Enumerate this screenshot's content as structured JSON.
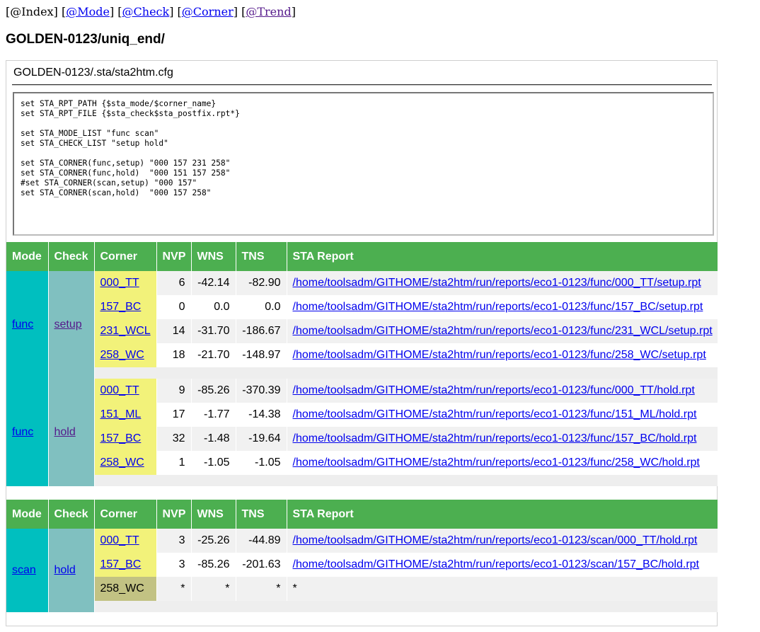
{
  "nav": {
    "open": "[",
    "close": "]",
    "index": "@Index",
    "mode": "@Mode",
    "check": "@Check",
    "corner": "@Corner",
    "trend": "@Trend"
  },
  "page_title": "GOLDEN-0123/uniq_end/",
  "config": {
    "title": "GOLDEN-0123/.sta/sta2htm.cfg",
    "content": "set STA_RPT_PATH {$sta_mode/$corner_name}\nset STA_RPT_FILE {$sta_check$sta_postfix.rpt*}\n\nset STA_MODE_LIST \"func scan\"\nset STA_CHECK_LIST \"setup hold\"\n\nset STA_CORNER(func,setup) \"000 157 231 258\"\nset STA_CORNER(func,hold)  \"000 151 157 258\"\n#set STA_CORNER(scan,setup) \"000 157\"\nset STA_CORNER(scan,hold)  \"000 157 258\""
  },
  "headers": [
    "Mode",
    "Check",
    "Corner",
    "NVP",
    "WNS",
    "TNS",
    "STA Report"
  ],
  "table1": {
    "groups": [
      {
        "mode": "func",
        "check": "setup",
        "rows": [
          {
            "corner": "000_TT",
            "nvp": "6",
            "wns": "-42.14",
            "tns": "-82.90",
            "report": "/home/toolsadm/GITHOME/sta2htm/run/reports/eco1-0123/func/000_TT/setup.rpt"
          },
          {
            "corner": "157_BC",
            "nvp": "0",
            "wns": "0.0",
            "tns": "0.0",
            "report": "/home/toolsadm/GITHOME/sta2htm/run/reports/eco1-0123/func/157_BC/setup.rpt"
          },
          {
            "corner": "231_WCL",
            "nvp": "14",
            "wns": "-31.70",
            "tns": "-186.67",
            "report": "/home/toolsadm/GITHOME/sta2htm/run/reports/eco1-0123/func/231_WCL/setup.rpt"
          },
          {
            "corner": "258_WC",
            "nvp": "18",
            "wns": "-21.70",
            "tns": "-148.97",
            "report": "/home/toolsadm/GITHOME/sta2htm/run/reports/eco1-0123/func/258_WC/setup.rpt"
          }
        ]
      },
      {
        "mode": "func",
        "check": "hold",
        "rows": [
          {
            "corner": "000_TT",
            "nvp": "9",
            "wns": "-85.26",
            "tns": "-370.39",
            "report": "/home/toolsadm/GITHOME/sta2htm/run/reports/eco1-0123/func/000_TT/hold.rpt"
          },
          {
            "corner": "151_ML",
            "nvp": "17",
            "wns": "-1.77",
            "tns": "-14.38",
            "report": "/home/toolsadm/GITHOME/sta2htm/run/reports/eco1-0123/func/151_ML/hold.rpt"
          },
          {
            "corner": "157_BC",
            "nvp": "32",
            "wns": "-1.48",
            "tns": "-19.64",
            "report": "/home/toolsadm/GITHOME/sta2htm/run/reports/eco1-0123/func/157_BC/hold.rpt"
          },
          {
            "corner": "258_WC",
            "nvp": "1",
            "wns": "-1.05",
            "tns": "-1.05",
            "report": "/home/toolsadm/GITHOME/sta2htm/run/reports/eco1-0123/func/258_WC/hold.rpt"
          }
        ]
      }
    ]
  },
  "table2": {
    "groups": [
      {
        "mode": "scan",
        "check": "hold",
        "rows": [
          {
            "corner": "000_TT",
            "nvp": "3",
            "wns": "-25.26",
            "tns": "-44.89",
            "report": "/home/toolsadm/GITHOME/sta2htm/run/reports/eco1-0123/scan/000_TT/hold.rpt"
          },
          {
            "corner": "157_BC",
            "nvp": "3",
            "wns": "-85.26",
            "tns": "-201.63",
            "report": "/home/toolsadm/GITHOME/sta2htm/run/reports/eco1-0123/scan/157_BC/hold.rpt"
          },
          {
            "corner": "258_WC",
            "nvp": "*",
            "wns": "*",
            "tns": "*",
            "report": "*",
            "missing": true
          }
        ]
      }
    ]
  },
  "colors": {
    "header_bg": "#4caf50",
    "mode_bg": "#00bfbf",
    "check_bg": "#80c0c0",
    "corner_bg": "#f2f27a",
    "corner_missing_bg": "#c2c283",
    "row_alt_bg": "#f1f1f1",
    "link": "#0000ee",
    "link_visited": "#551a8b"
  }
}
